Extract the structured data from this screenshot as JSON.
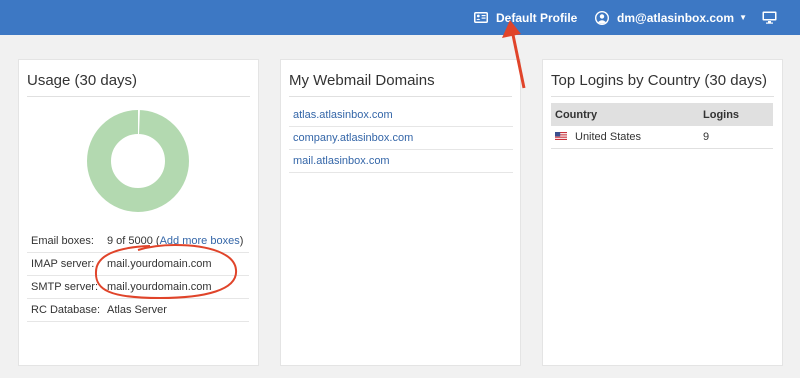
{
  "topbar": {
    "profile_label": "Default Profile",
    "user_label": "dm@atlasinbox.com",
    "profile_icon": "id-card-icon",
    "user_icon": "user-circle-icon",
    "monitor_icon": "monitor-icon",
    "bg_color": "#3d78c4"
  },
  "usage": {
    "title": "Usage (30 days)",
    "donut": {
      "used": 9,
      "total": 5000,
      "used_color": "#ffffff",
      "free_color": "#b3d9b0"
    },
    "rows": [
      {
        "label": "Email boxes:",
        "value": "9 of 5000 (",
        "link": "Add more boxes",
        "suffix": ")"
      },
      {
        "label": "IMAP server:",
        "value": "mail.yourdomain.com"
      },
      {
        "label": "SMTP server:",
        "value": "mail.yourdomain.com"
      },
      {
        "label": "RC Database:",
        "value": "Atlas Server"
      }
    ]
  },
  "domains": {
    "title": "My Webmail Domains",
    "items": [
      "atlas.atlasinbox.com",
      "company.atlasinbox.com",
      "mail.atlasinbox.com"
    ]
  },
  "logins": {
    "title": "Top Logins by Country (30 days)",
    "columns": [
      "Country",
      "Logins"
    ],
    "rows": [
      {
        "country": "United States",
        "logins": "9",
        "flag_icon": "us-flag-icon"
      }
    ]
  },
  "annotations": {
    "color": "#e0442a"
  }
}
